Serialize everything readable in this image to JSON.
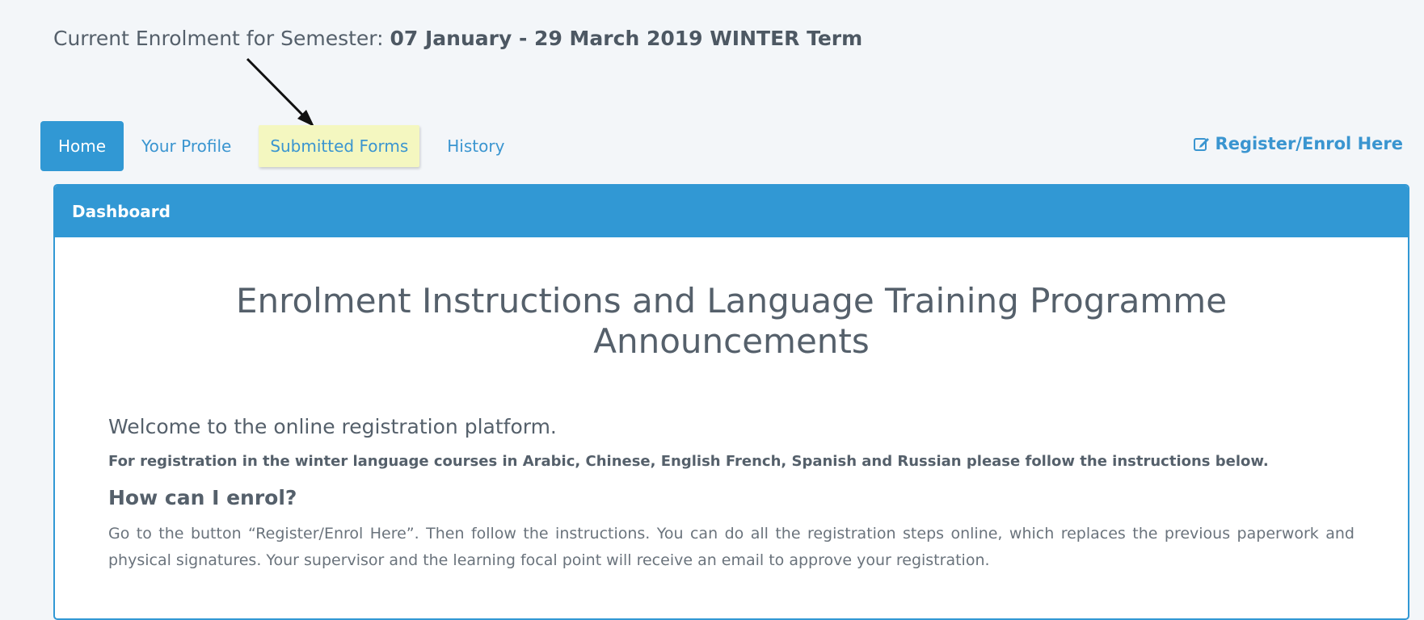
{
  "semester": {
    "label": "Current Enrolment for Semester:",
    "value": "07 January - 29 March 2019 WINTER Term"
  },
  "nav": {
    "tabs": [
      {
        "label": "Home",
        "active": true
      },
      {
        "label": "Your Profile"
      },
      {
        "label": "Submitted Forms",
        "highlighted": true
      },
      {
        "label": "History"
      }
    ],
    "register_label": "Register/Enrol Here",
    "register_icon": "edit-icon"
  },
  "panel": {
    "heading": "Dashboard",
    "title": "Enrolment Instructions and Language Training Programme Announcements",
    "welcome": "Welcome to the online registration platform.",
    "lead": "For registration in the winter language courses in Arabic, Chinese, English French, Spanish and Russian please follow the instructions below.",
    "section_heading": "How can I enrol?",
    "body": "Go to the button “Register/Enrol Here”. Then follow the instructions. You can do all the registration steps online, which replaces the previous paperwork and physical signatures. Your supervisor and the learning focal point will receive an email to approve your registration."
  },
  "colors": {
    "primary": "#3198d4",
    "highlight": "#f4f7c0",
    "background": "#f3f6f9"
  }
}
